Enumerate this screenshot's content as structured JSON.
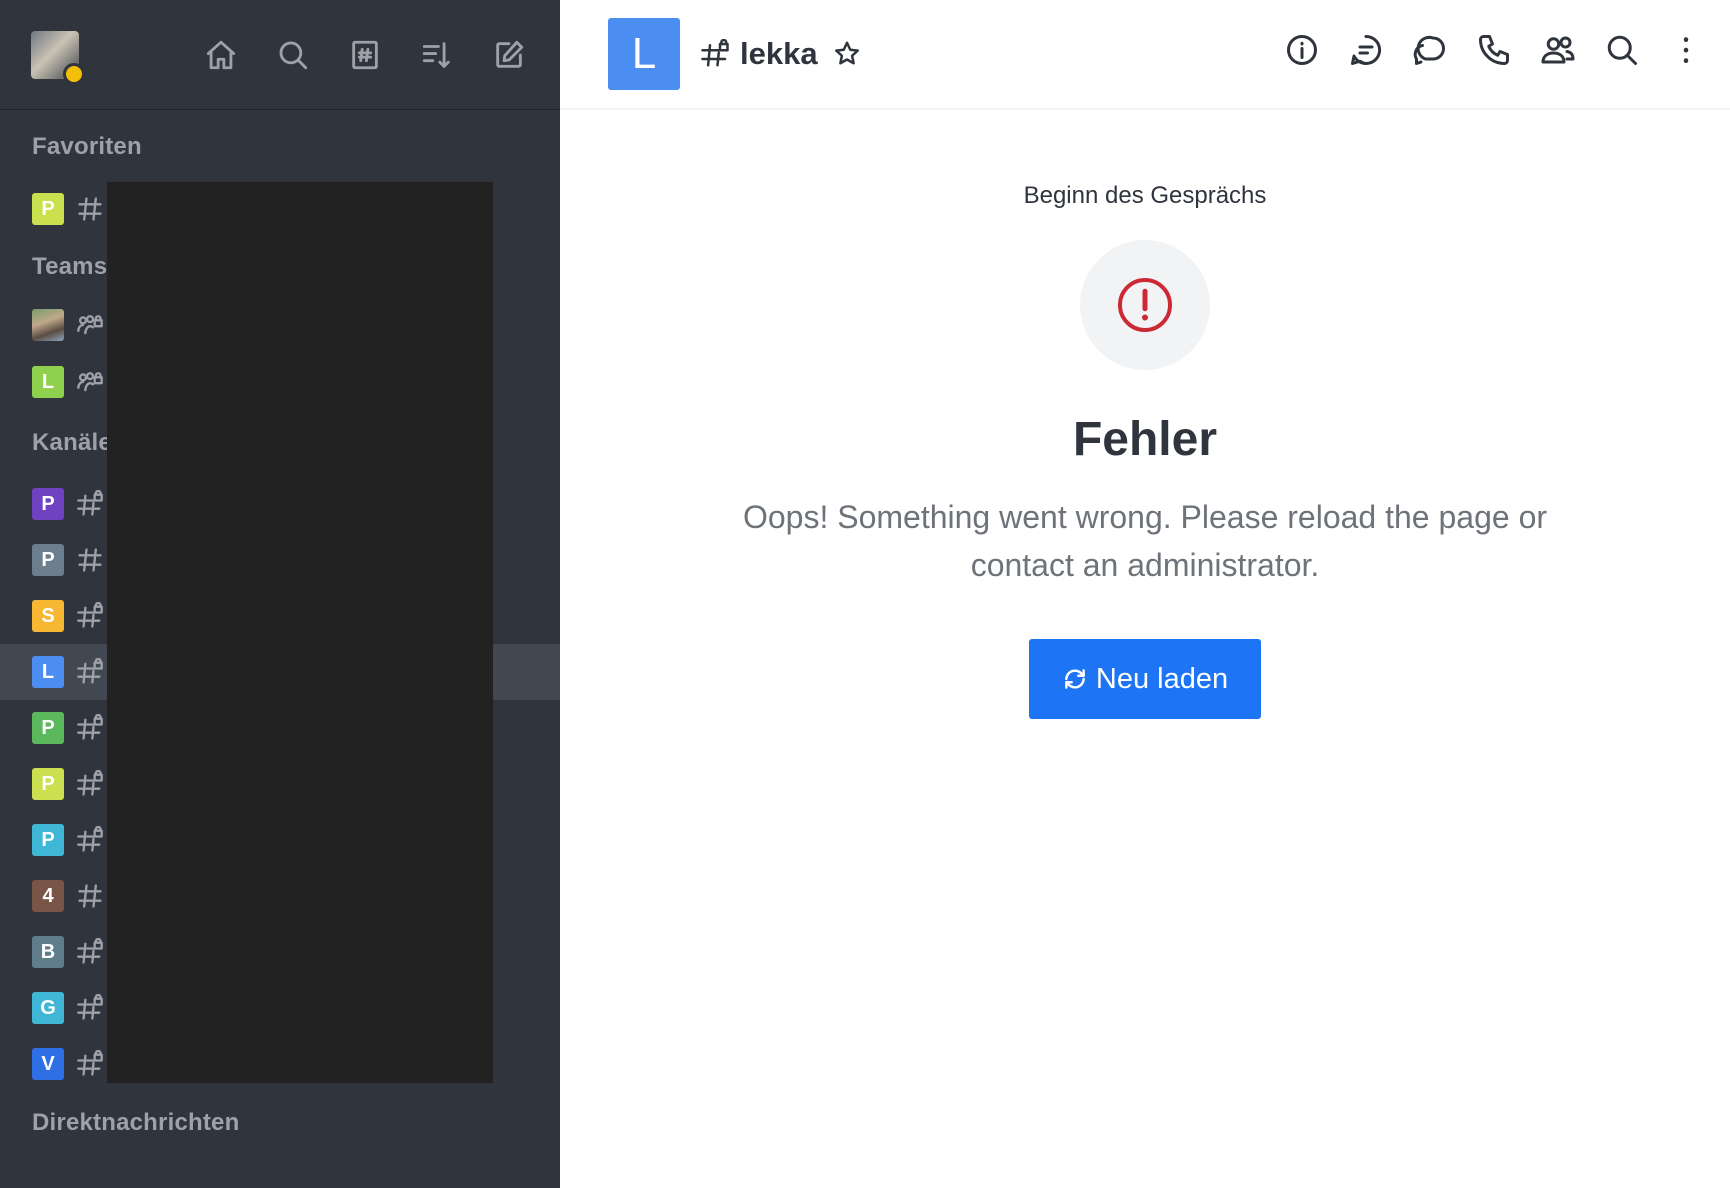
{
  "sidebar": {
    "sections": {
      "favorites": "Favoriten",
      "teams": "Teams",
      "channels": "Kanäle",
      "direct": "Direktnachrichten"
    },
    "favorites": [
      {
        "letter": "P",
        "color": "#cbe04f"
      }
    ],
    "teams": [
      {
        "letter": "",
        "color": ""
      },
      {
        "letter": "L",
        "color": "#8fd14f"
      }
    ],
    "channels": [
      {
        "letter": "P",
        "color": "#6f42c1",
        "icon": "hashtag-lock-icon"
      },
      {
        "letter": "P",
        "color": "#6c7f8f",
        "icon": "hashtag-icon"
      },
      {
        "letter": "S",
        "color": "#f7b733",
        "icon": "hashtag-lock-icon"
      },
      {
        "letter": "L",
        "color": "#4b8df0",
        "icon": "hashtag-lock-icon",
        "active": true
      },
      {
        "letter": "P",
        "color": "#5cb85c",
        "icon": "hashtag-lock-icon"
      },
      {
        "letter": "P",
        "color": "#cbe04f",
        "icon": "hashtag-lock-icon"
      },
      {
        "letter": "P",
        "color": "#3fb6d6",
        "icon": "hashtag-lock-icon"
      },
      {
        "letter": "4",
        "color": "#795548",
        "icon": "hashtag-icon"
      },
      {
        "letter": "B",
        "color": "#607d8b",
        "icon": "hashtag-lock-icon"
      },
      {
        "letter": "G",
        "color": "#3fb6d6",
        "icon": "hashtag-lock-icon"
      },
      {
        "letter": "V",
        "color": "#2e6fe6",
        "icon": "hashtag-lock-icon"
      }
    ]
  },
  "header": {
    "room_letter": "L",
    "room_name": "lekka"
  },
  "main": {
    "start_label": "Beginn des Gesprächs",
    "error_title": "Fehler",
    "error_message": "Oops! Something went wrong. Please reload the page or contact an administrator.",
    "reload_label": "Neu laden"
  },
  "colors": {
    "sidebar_bg": "#2f343d",
    "accent": "#1d74f5",
    "error": "#cc2936"
  }
}
